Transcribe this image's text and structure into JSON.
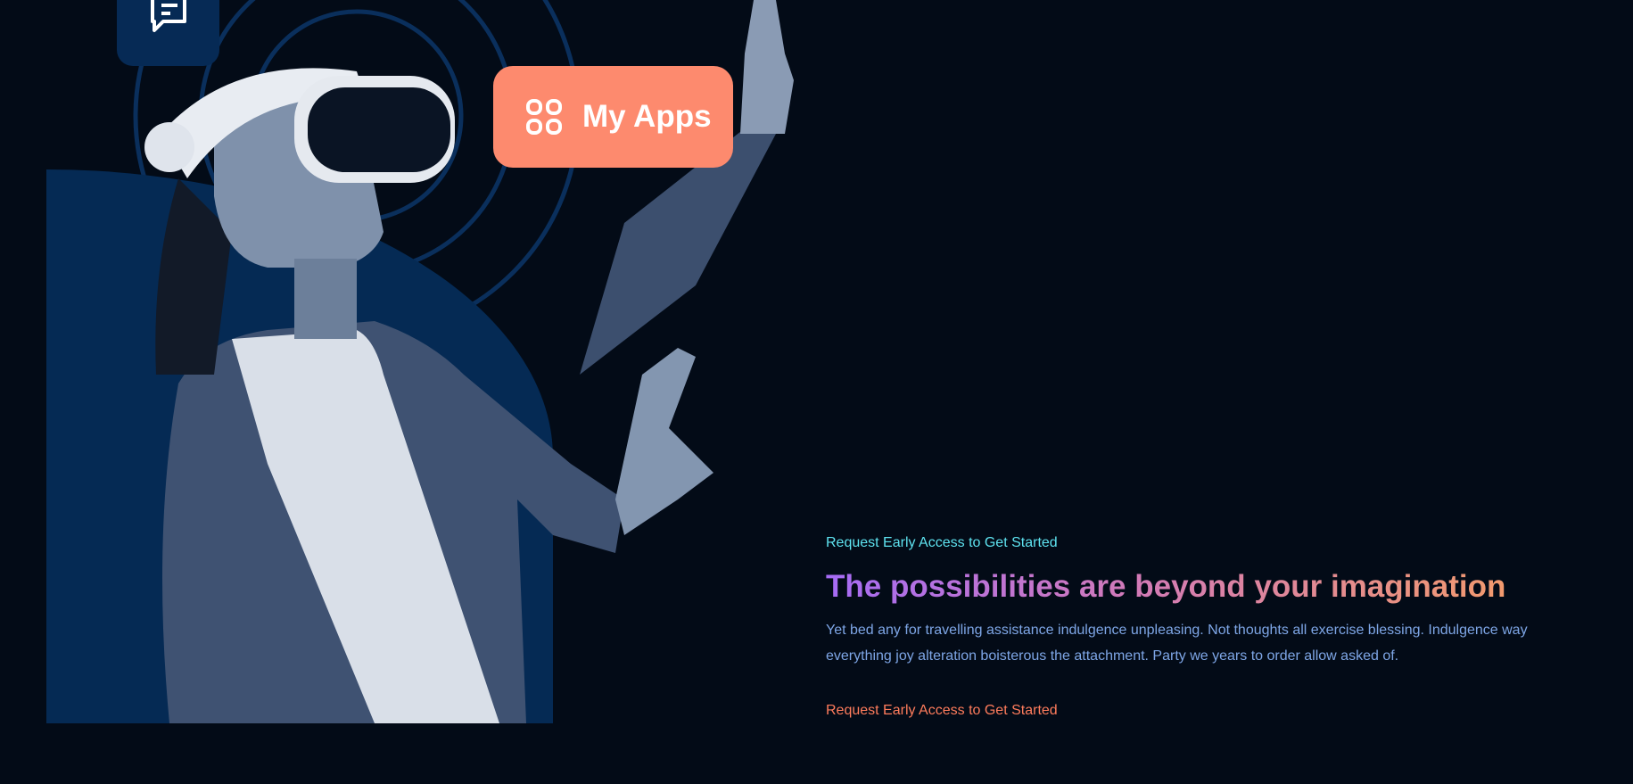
{
  "hero": {
    "apps_badge": {
      "label": "My Apps",
      "icon": "grid-icon"
    },
    "chat_badge": {
      "icon": "chat-icon"
    },
    "eyebrow": "Request Early Access to Get Started",
    "heading": "The possibilities are beyond your imagination",
    "paragraph": "Yet bed any for travelling assistance indulgence unpleasing. Not thoughts all exercise blessing. Indulgence way everything joy alteration boisterous the attachment. Party we years to order allow asked of.",
    "cta": "Request Early Access to Get Started"
  },
  "colors": {
    "background": "#030b17",
    "accent": "#fd8a6e",
    "navy": "#052a54",
    "eyebrow": "#5ee3f0"
  }
}
